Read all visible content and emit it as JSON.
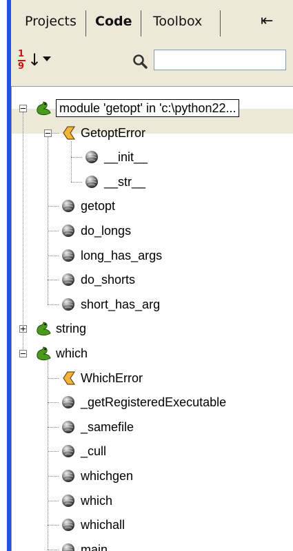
{
  "tabs": [
    {
      "label": "Projects",
      "active": false
    },
    {
      "label": "Code",
      "active": true
    },
    {
      "label": "Toolbox",
      "active": false
    }
  ],
  "dock_glyph": "⇤",
  "toolbar": {
    "sort_icon": "sort-numeric-icon",
    "search_icon": "magnifier-icon",
    "search_value": ""
  },
  "colors": {
    "panel": "#ece9d8",
    "accent_bar": "#1f55d8",
    "class_icon": "#f2b43a",
    "module_icon": "#4a9a1e"
  },
  "tree": {
    "nodes": [
      {
        "label": "module 'getopt' in 'c:\\python22...",
        "icon": "python-module-icon",
        "expander": "minus"
      },
      {
        "label": "GetoptError",
        "icon": "class-icon",
        "expander": "minus"
      },
      {
        "label": "__init__",
        "icon": "function-icon"
      },
      {
        "label": "__str__",
        "icon": "function-icon"
      },
      {
        "label": "getopt",
        "icon": "function-icon"
      },
      {
        "label": "do_longs",
        "icon": "function-icon"
      },
      {
        "label": "long_has_args",
        "icon": "function-icon"
      },
      {
        "label": "do_shorts",
        "icon": "function-icon"
      },
      {
        "label": "short_has_arg",
        "icon": "function-icon"
      },
      {
        "label": "string",
        "icon": "python-module-icon",
        "expander": "plus"
      },
      {
        "label": "which",
        "icon": "python-module-icon",
        "expander": "minus"
      },
      {
        "label": "WhichError",
        "icon": "class-icon"
      },
      {
        "label": "_getRegisteredExecutable",
        "icon": "function-icon"
      },
      {
        "label": "_samefile",
        "icon": "function-icon"
      },
      {
        "label": "_cull",
        "icon": "function-icon"
      },
      {
        "label": "whichgen",
        "icon": "function-icon"
      },
      {
        "label": "which",
        "icon": "function-icon"
      },
      {
        "label": "whichall",
        "icon": "function-icon"
      },
      {
        "label": "main",
        "icon": "function-icon"
      }
    ]
  }
}
